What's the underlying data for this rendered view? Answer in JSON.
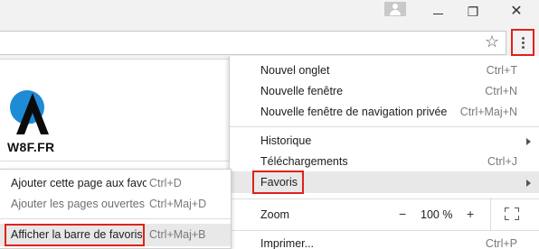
{
  "window": {
    "minimize_label": "",
    "restore_label": "❐",
    "close_label": "✕"
  },
  "toolbar": {
    "omnibox_value": "",
    "star_icon": "☆"
  },
  "logo": {
    "text": "W8F.FR",
    "colors": {
      "primary": "#1d8bd6",
      "dark": "#0b0b0b"
    }
  },
  "menu": {
    "items": [
      {
        "label": "Nouvel onglet",
        "shortcut": "Ctrl+T"
      },
      {
        "label": "Nouvelle fenêtre",
        "shortcut": "Ctrl+N"
      },
      {
        "label": "Nouvelle fenêtre de navigation privée",
        "shortcut": "Ctrl+Maj+N"
      },
      {
        "label": "Historique",
        "shortcut": ""
      },
      {
        "label": "Téléchargements",
        "shortcut": "Ctrl+J"
      },
      {
        "label": "Favoris",
        "shortcut": ""
      },
      {
        "label": "Zoom",
        "shortcut": ""
      },
      {
        "label": "Imprimer...",
        "shortcut": "Ctrl+P"
      }
    ],
    "zoom": {
      "minus": "−",
      "value": "100 %",
      "plus": "+"
    }
  },
  "submenu": {
    "items": [
      {
        "label": "Ajouter cette page aux favoris...",
        "shortcut": "Ctrl+D"
      },
      {
        "label": "Ajouter les pages ouvertes aux favoris...",
        "shortcut": "Ctrl+Maj+D"
      },
      {
        "label": "Afficher la barre de favoris",
        "shortcut": "Ctrl+Maj+B"
      }
    ]
  },
  "colors": {
    "highlight_box": "#e0211c",
    "hover_bg": "#e8e8e8"
  }
}
